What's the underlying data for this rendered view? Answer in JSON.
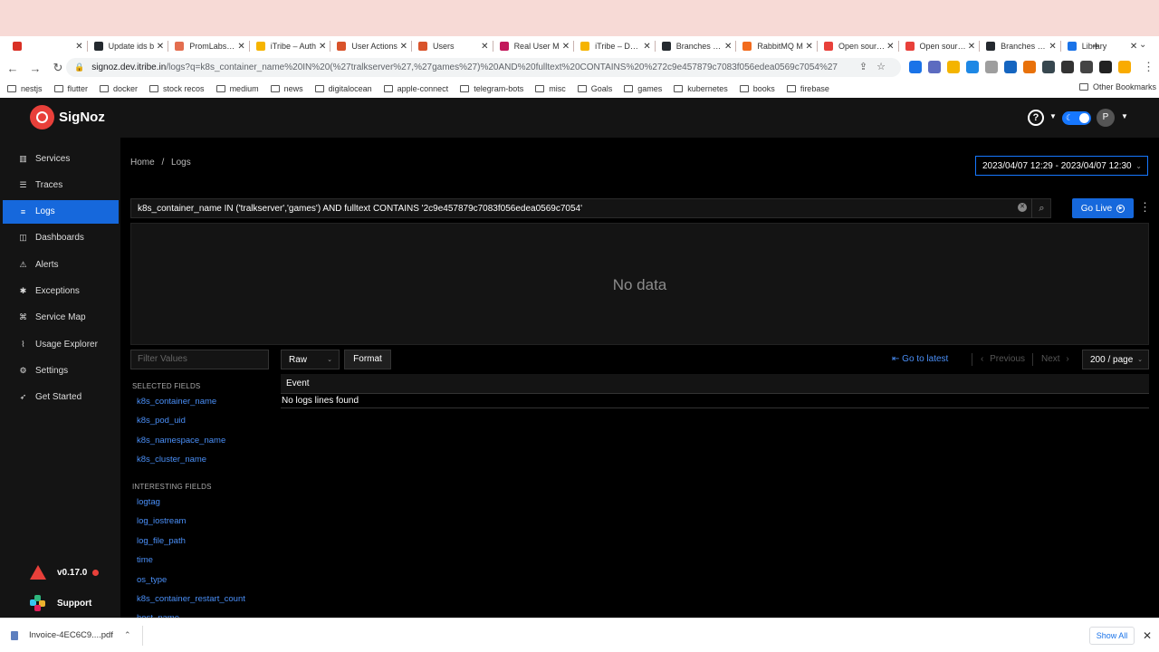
{
  "browser": {
    "tabs": [
      {
        "title": "",
        "color": "#d93025"
      },
      {
        "title": "Update ids b",
        "color": "#24292f"
      },
      {
        "title": "PromLabs | P",
        "color": "#e46e4f"
      },
      {
        "title": "iTribe – Auth",
        "color": "#f6b400"
      },
      {
        "title": "User Actions",
        "color": "#d9532b"
      },
      {
        "title": "Users",
        "color": "#d9532b"
      },
      {
        "title": "Real User M",
        "color": "#c2185b"
      },
      {
        "title": "iTribe – Dash",
        "color": "#f6b400"
      },
      {
        "title": "Branches · m",
        "color": "#24292f"
      },
      {
        "title": "RabbitMQ M",
        "color": "#f26b1d"
      },
      {
        "title": "Open source",
        "color": "#e8403a"
      },
      {
        "title": "Open source",
        "color": "#e8403a",
        "active": true
      },
      {
        "title": "Branches · m",
        "color": "#24292f"
      },
      {
        "title": "Library",
        "color": "#1a73e8"
      }
    ],
    "new_tab": "+",
    "url_host": "signoz.dev.itribe.in",
    "url_path": "/logs?q=k8s_container_name%20IN%20(%27tralkserver%27,%27games%27)%20AND%20fulltext%20CONTAINS%20%272c9e457879c7083f056edea0569c7054%27",
    "bookmarks": [
      "nestjs",
      "flutter",
      "docker",
      "stock recos",
      "medium",
      "news",
      "digitalocean",
      "apple-connect",
      "telegram-bots",
      "misc",
      "Goals",
      "games",
      "kubernetes",
      "books",
      "firebase"
    ],
    "other_bookmarks": "Other Bookmarks",
    "extension_colors": [
      "#1a73e8",
      "#5c6bc0",
      "#f4b400",
      "#1e88e5",
      "#9e9e9e",
      "#1565c0",
      "#e8710a",
      "#37474f",
      "#333333",
      "#444444",
      "#222222",
      "#f9ab00"
    ]
  },
  "app": {
    "brand": "SigNoz",
    "user_initial": "P",
    "sidebar": [
      {
        "label": "Services",
        "icon": "bar-chart-icon"
      },
      {
        "label": "Traces",
        "icon": "list-icon"
      },
      {
        "label": "Logs",
        "icon": "bars-icon",
        "active": true
      },
      {
        "label": "Dashboards",
        "icon": "dashboard-icon"
      },
      {
        "label": "Alerts",
        "icon": "alert-icon"
      },
      {
        "label": "Exceptions",
        "icon": "bug-icon"
      },
      {
        "label": "Service Map",
        "icon": "map-icon"
      },
      {
        "label": "Usage Explorer",
        "icon": "line-chart-icon"
      },
      {
        "label": "Settings",
        "icon": "gear-icon"
      },
      {
        "label": "Get Started",
        "icon": "rocket-icon"
      }
    ],
    "version": "v0.17.0",
    "support": "Support",
    "breadcrumb": {
      "home": "Home",
      "sep": "/",
      "current": "Logs"
    },
    "time_range": "2023/04/07 12:29 - 2023/04/07 12:30",
    "query": "k8s_container_name IN ('tralkserver','games') AND fulltext CONTAINS '2c9e457879c7083f056edea0569c7054'",
    "go_live": "Go Live",
    "no_data": "No data",
    "filter_placeholder": "Filter Values",
    "selected_fields_header": "SELECTED FIELDS",
    "selected_fields": [
      "k8s_container_name",
      "k8s_pod_uid",
      "k8s_namespace_name",
      "k8s_cluster_name"
    ],
    "interesting_fields_header": "INTERESTING FIELDS",
    "interesting_fields": [
      "logtag",
      "log_iostream",
      "log_file_path",
      "time",
      "os_type",
      "k8s_container_restart_count",
      "host_name"
    ],
    "view_mode": "Raw",
    "format_label": "Format",
    "go_to_latest": "Go to latest",
    "previous": "Previous",
    "next": "Next",
    "page_size": "200 / page",
    "table_header": "Event",
    "empty_message": "No logs lines found"
  },
  "downloads": {
    "file": "Invoice-4EC6C9....pdf",
    "show_all": "Show All"
  }
}
